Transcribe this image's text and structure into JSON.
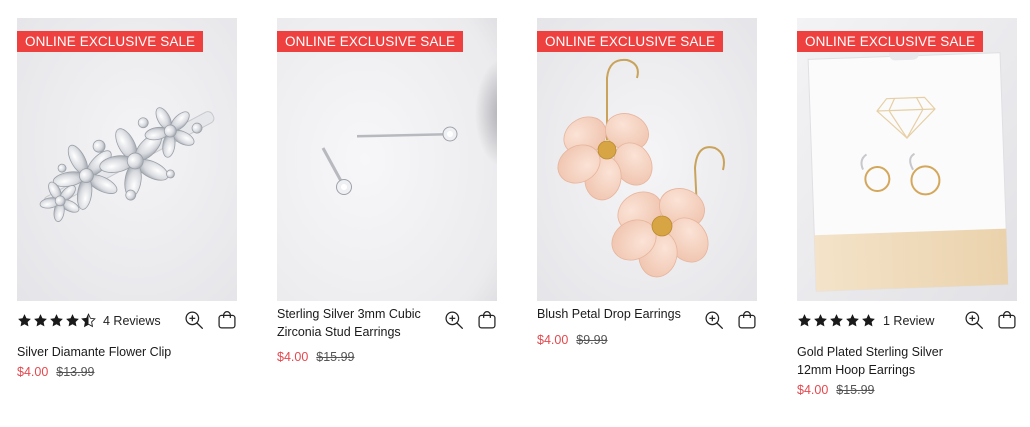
{
  "colors": {
    "badge": "#ef4040",
    "sale_price": "#e5484d",
    "star": "#1a1a1a"
  },
  "products": [
    {
      "badge": "ONLINE EXCLUSIVE SALE",
      "rating_stars": 4.5,
      "reviews": "4 Reviews",
      "title": "Silver Diamante Flower Clip",
      "price": "$4.00",
      "was_price": "$13.99"
    },
    {
      "badge": "ONLINE EXCLUSIVE SALE",
      "title": "Sterling Silver 3mm Cubic Zirconia Stud Earrings",
      "price": "$4.00",
      "was_price": "$15.99"
    },
    {
      "badge": "ONLINE EXCLUSIVE SALE",
      "title": "Blush Petal Drop Earrings",
      "price": "$4.00",
      "was_price": "$9.99"
    },
    {
      "badge": "ONLINE EXCLUSIVE SALE",
      "rating_stars": 5,
      "reviews": "1 Review",
      "title": "Gold Plated Sterling Silver 12mm Hoop Earrings",
      "price": "$4.00",
      "was_price": "$15.99"
    }
  ],
  "icons": {
    "quick_view": "zoom-in-icon",
    "add_to_bag": "shopping-bag-icon",
    "rating": "star-icon"
  }
}
